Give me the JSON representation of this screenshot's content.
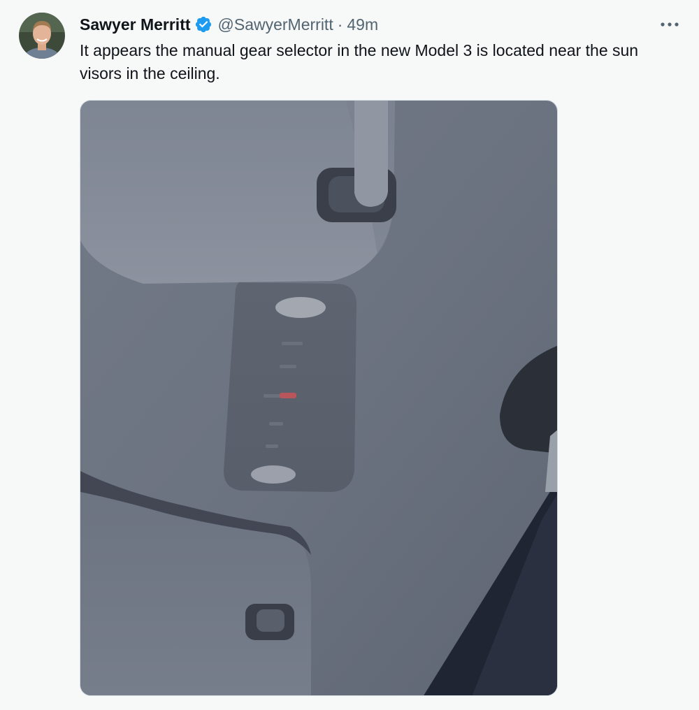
{
  "tweet": {
    "author": {
      "display_name": "Sawyer Merritt",
      "handle": "@SawyerMerritt",
      "verified": true,
      "avatar_icon": "user-avatar-photo"
    },
    "separator": "·",
    "timestamp": "49m",
    "more_icon": "more-horizontal-icon",
    "text": "It appears the manual gear selector in the new Model 3 is located near the sun visors in the ceiling.",
    "media": {
      "type": "photo",
      "subject": "overhead console with gear selector panel near sun visors"
    }
  },
  "colors": {
    "background": "#f7f9f9",
    "text_primary": "#0f1419",
    "text_secondary": "#536471",
    "verified_blue": "#1d9bf0"
  }
}
